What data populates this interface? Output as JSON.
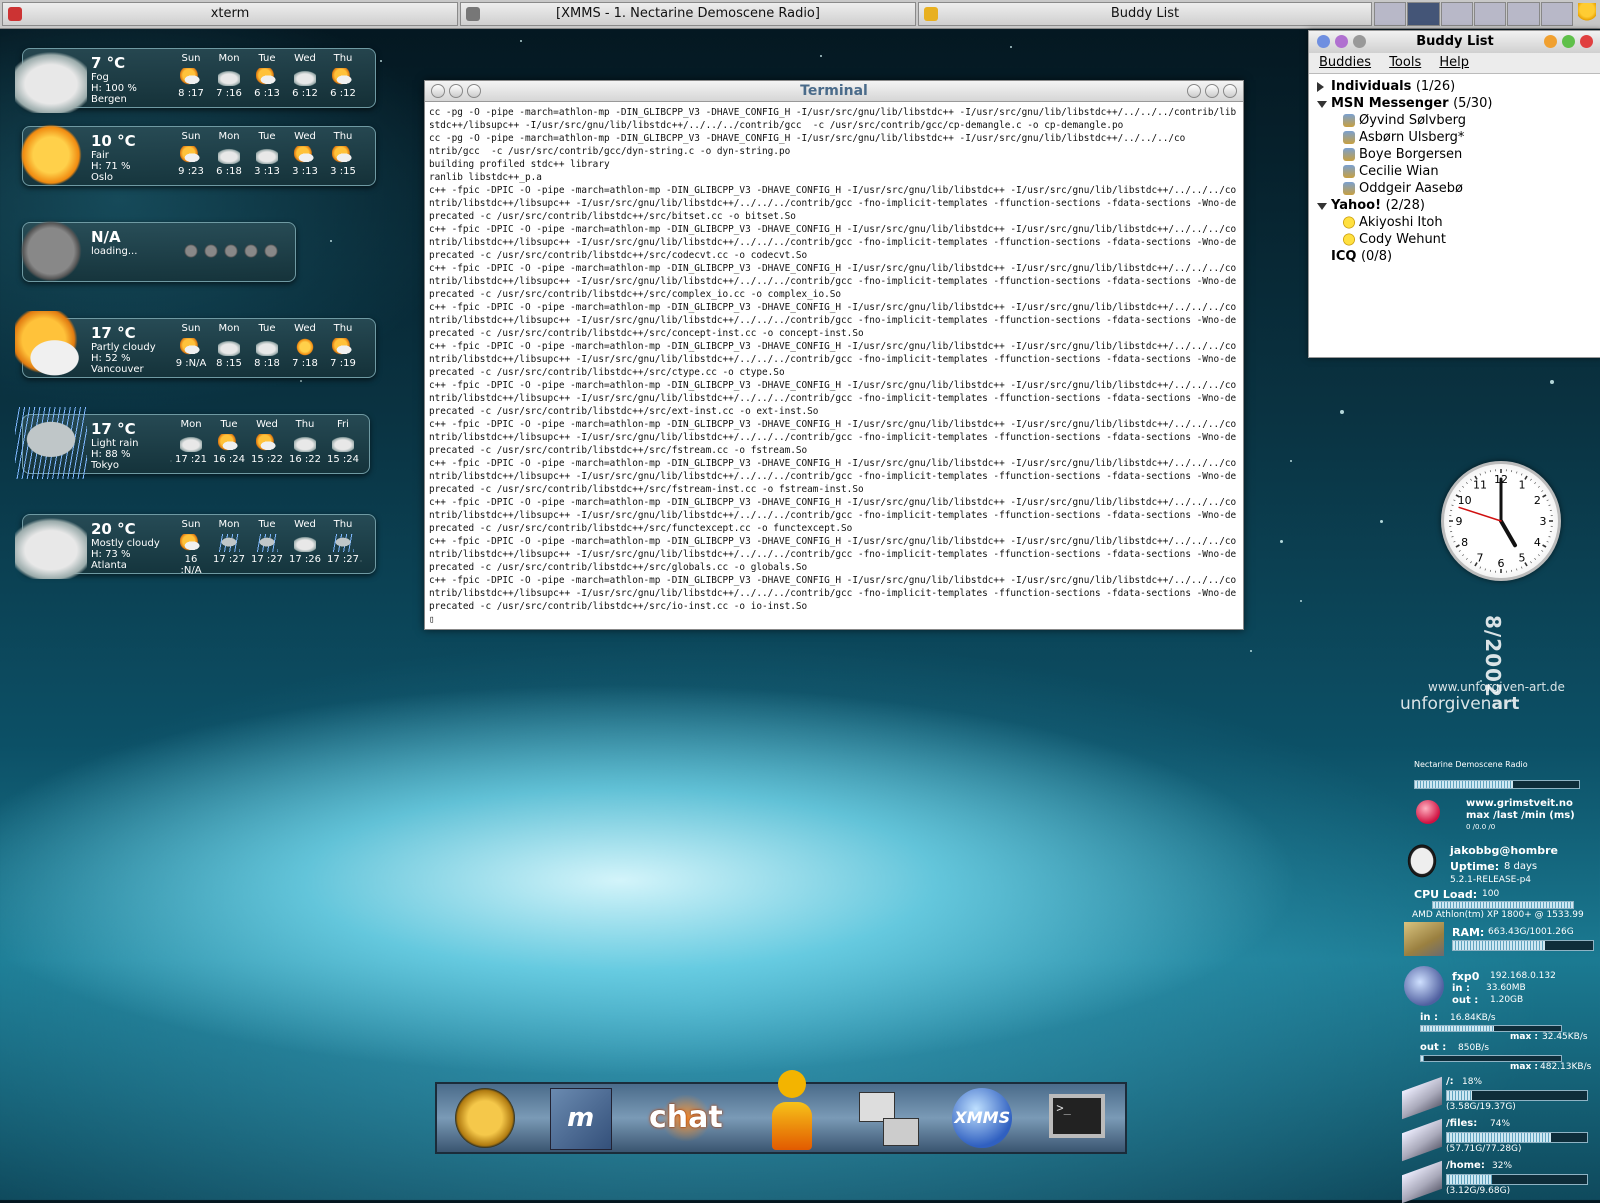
{
  "taskbar": {
    "tasks": [
      {
        "label": "xterm"
      },
      {
        "label": "[XMMS - 1. Nectarine Demoscene Radio]"
      },
      {
        "label": "Buddy List"
      }
    ]
  },
  "weather": [
    {
      "temp": "7 °C",
      "cond": "Fog",
      "humidity": "H: 100 %",
      "city": "Bergen",
      "icon": "fog-icon",
      "forecast": [
        {
          "day": "Sun",
          "time": "8 :17",
          "icon": "partly-sunny-icon"
        },
        {
          "day": "Mon",
          "time": "7 :16",
          "icon": "cloudy-icon"
        },
        {
          "day": "Tue",
          "time": "6 :13",
          "icon": "partly-sunny-icon"
        },
        {
          "day": "Wed",
          "time": "6 :12",
          "icon": "cloudy-icon"
        },
        {
          "day": "Thu",
          "time": "6 :12",
          "icon": "partly-sunny-icon"
        }
      ]
    },
    {
      "temp": "10 °C",
      "cond": "Fair",
      "humidity": "H: 71 %",
      "city": "Oslo",
      "icon": "sun-icon",
      "forecast": [
        {
          "day": "Sun",
          "time": "9 :23",
          "icon": "partly-sunny-icon"
        },
        {
          "day": "Mon",
          "time": "6 :18",
          "icon": "cloudy-icon"
        },
        {
          "day": "Tue",
          "time": "3 :13",
          "icon": "cloudy-icon"
        },
        {
          "day": "Wed",
          "time": "3 :13",
          "icon": "partly-sunny-icon"
        },
        {
          "day": "Thu",
          "time": "3 :15",
          "icon": "partly-sunny-icon"
        }
      ]
    },
    {
      "temp": "N/A",
      "cond": "loading...",
      "humidity": "",
      "city": "",
      "icon": "unknown-icon",
      "forecast": []
    },
    {
      "temp": "17 °C",
      "cond": "Partly cloudy",
      "humidity": "H: 52 %",
      "city": "Vancouver",
      "icon": "partly-cloudy-icon",
      "forecast": [
        {
          "day": "Sun",
          "time": "9 :N/A",
          "icon": "partly-sunny-icon"
        },
        {
          "day": "Mon",
          "time": "8 :15",
          "icon": "cloudy-icon"
        },
        {
          "day": "Tue",
          "time": "8 :18",
          "icon": "cloudy-icon"
        },
        {
          "day": "Wed",
          "time": "7 :18",
          "icon": "sun-icon"
        },
        {
          "day": "Thu",
          "time": "7 :19",
          "icon": "partly-sunny-icon"
        }
      ]
    },
    {
      "temp": "17 °C",
      "cond": "Light rain",
      "humidity": "H: 88 %",
      "city": "Tokyo",
      "icon": "rain-icon",
      "forecast": [
        {
          "day": "Mon",
          "time": "17 :21",
          "icon": "cloudy-icon"
        },
        {
          "day": "Tue",
          "time": "16 :24",
          "icon": "partly-sunny-icon"
        },
        {
          "day": "Wed",
          "time": "15 :22",
          "icon": "partly-sunny-icon"
        },
        {
          "day": "Thu",
          "time": "16 :22",
          "icon": "cloudy-icon"
        },
        {
          "day": "Fri",
          "time": "15 :24",
          "icon": "cloudy-icon"
        }
      ]
    },
    {
      "temp": "20 °C",
      "cond": "Mostly cloudy",
      "humidity": "H: 73 %",
      "city": "Atlanta",
      "icon": "mostly-cloudy-icon",
      "forecast": [
        {
          "day": "Sun",
          "time": "16 :N/A",
          "icon": "partly-sunny-icon"
        },
        {
          "day": "Mon",
          "time": "17 :27",
          "icon": "thunder-icon"
        },
        {
          "day": "Tue",
          "time": "17 :27",
          "icon": "thunder-icon"
        },
        {
          "day": "Wed",
          "time": "17 :26",
          "icon": "cloudy-icon"
        },
        {
          "day": "Thu",
          "time": "17 :27",
          "icon": "thunder-icon"
        }
      ]
    }
  ],
  "terminal": {
    "title": "Terminal",
    "text": "cc -pg -O -pipe -march=athlon-mp -DIN_GLIBCPP_V3 -DHAVE_CONFIG_H -I/usr/src/gnu/lib/libstdc++ -I/usr/src/gnu/lib/libstdc++/../../../contrib/libstdc++/libsupc++ -I/usr/src/gnu/lib/libstdc++/../../../contrib/gcc  -c /usr/src/contrib/gcc/cp-demangle.c -o cp-demangle.po\ncc -pg -O -pipe -march=athlon-mp -DIN_GLIBCPP_V3 -DHAVE_CONFIG_H -I/usr/src/gnu/lib/libstdc++ -I/usr/src/gnu/lib/libstdc++/../../../co\nntrib/gcc  -c /usr/src/contrib/gcc/dyn-string.c -o dyn-string.po\nbuilding profiled stdc++ library\nranlib libstdc++_p.a\nc++ -fpic -DPIC -O -pipe -march=athlon-mp -DIN_GLIBCPP_V3 -DHAVE_CONFIG_H -I/usr/src/gnu/lib/libstdc++ -I/usr/src/gnu/lib/libstdc++/../../../contrib/libstdc++/libsupc++ -I/usr/src/gnu/lib/libstdc++/../../../contrib/gcc -fno-implicit-templates -ffunction-sections -fdata-sections -Wno-deprecated -c /usr/src/contrib/libstdc++/src/bitset.cc -o bitset.So\nc++ -fpic -DPIC -O -pipe -march=athlon-mp -DIN_GLIBCPP_V3 -DHAVE_CONFIG_H -I/usr/src/gnu/lib/libstdc++ -I/usr/src/gnu/lib/libstdc++/../../../contrib/libstdc++/libsupc++ -I/usr/src/gnu/lib/libstdc++/../../../contrib/gcc -fno-implicit-templates -ffunction-sections -fdata-sections -Wno-deprecated -c /usr/src/contrib/libstdc++/src/codecvt.cc -o codecvt.So\nc++ -fpic -DPIC -O -pipe -march=athlon-mp -DIN_GLIBCPP_V3 -DHAVE_CONFIG_H -I/usr/src/gnu/lib/libstdc++ -I/usr/src/gnu/lib/libstdc++/../../../contrib/libstdc++/libsupc++ -I/usr/src/gnu/lib/libstdc++/../../../contrib/gcc -fno-implicit-templates -ffunction-sections -fdata-sections -Wno-deprecated -c /usr/src/contrib/libstdc++/src/complex_io.cc -o complex_io.So\nc++ -fpic -DPIC -O -pipe -march=athlon-mp -DIN_GLIBCPP_V3 -DHAVE_CONFIG_H -I/usr/src/gnu/lib/libstdc++ -I/usr/src/gnu/lib/libstdc++/../../../contrib/libstdc++/libsupc++ -I/usr/src/gnu/lib/libstdc++/../../../contrib/gcc -fno-implicit-templates -ffunction-sections -fdata-sections -Wno-deprecated -c /usr/src/contrib/libstdc++/src/concept-inst.cc -o concept-inst.So\nc++ -fpic -DPIC -O -pipe -march=athlon-mp -DIN_GLIBCPP_V3 -DHAVE_CONFIG_H -I/usr/src/gnu/lib/libstdc++ -I/usr/src/gnu/lib/libstdc++/../../../contrib/libstdc++/libsupc++ -I/usr/src/gnu/lib/libstdc++/../../../contrib/gcc -fno-implicit-templates -ffunction-sections -fdata-sections -Wno-deprecated -c /usr/src/contrib/libstdc++/src/ctype.cc -o ctype.So\nc++ -fpic -DPIC -O -pipe -march=athlon-mp -DIN_GLIBCPP_V3 -DHAVE_CONFIG_H -I/usr/src/gnu/lib/libstdc++ -I/usr/src/gnu/lib/libstdc++/../../../contrib/libstdc++/libsupc++ -I/usr/src/gnu/lib/libstdc++/../../../contrib/gcc -fno-implicit-templates -ffunction-sections -fdata-sections -Wno-deprecated -c /usr/src/contrib/libstdc++/src/ext-inst.cc -o ext-inst.So\nc++ -fpic -DPIC -O -pipe -march=athlon-mp -DIN_GLIBCPP_V3 -DHAVE_CONFIG_H -I/usr/src/gnu/lib/libstdc++ -I/usr/src/gnu/lib/libstdc++/../../../contrib/libstdc++/libsupc++ -I/usr/src/gnu/lib/libstdc++/../../../contrib/gcc -fno-implicit-templates -ffunction-sections -fdata-sections -Wno-deprecated -c /usr/src/contrib/libstdc++/src/fstream.cc -o fstream.So\nc++ -fpic -DPIC -O -pipe -march=athlon-mp -DIN_GLIBCPP_V3 -DHAVE_CONFIG_H -I/usr/src/gnu/lib/libstdc++ -I/usr/src/gnu/lib/libstdc++/../../../contrib/libstdc++/libsupc++ -I/usr/src/gnu/lib/libstdc++/../../../contrib/gcc -fno-implicit-templates -ffunction-sections -fdata-sections -Wno-deprecated -c /usr/src/contrib/libstdc++/src/fstream-inst.cc -o fstream-inst.So\nc++ -fpic -DPIC -O -pipe -march=athlon-mp -DIN_GLIBCPP_V3 -DHAVE_CONFIG_H -I/usr/src/gnu/lib/libstdc++ -I/usr/src/gnu/lib/libstdc++/../../../contrib/libstdc++/libsupc++ -I/usr/src/gnu/lib/libstdc++/../../../contrib/gcc -fno-implicit-templates -ffunction-sections -fdata-sections -Wno-deprecated -c /usr/src/contrib/libstdc++/src/functexcept.cc -o functexcept.So\nc++ -fpic -DPIC -O -pipe -march=athlon-mp -DIN_GLIBCPP_V3 -DHAVE_CONFIG_H -I/usr/src/gnu/lib/libstdc++ -I/usr/src/gnu/lib/libstdc++/../../../contrib/libstdc++/libsupc++ -I/usr/src/gnu/lib/libstdc++/../../../contrib/gcc -fno-implicit-templates -ffunction-sections -fdata-sections -Wno-deprecated -c /usr/src/contrib/libstdc++/src/globals.cc -o globals.So\nc++ -fpic -DPIC -O -pipe -march=athlon-mp -DIN_GLIBCPP_V3 -DHAVE_CONFIG_H -I/usr/src/gnu/lib/libstdc++ -I/usr/src/gnu/lib/libstdc++/../../../contrib/libstdc++/libsupc++ -I/usr/src/gnu/lib/libstdc++/../../../contrib/gcc -fno-implicit-templates -ffunction-sections -fdata-sections -Wno-deprecated -c /usr/src/contrib/libstdc++/src/io-inst.cc -o io-inst.So\n▯"
  },
  "buddy": {
    "title": "Buddy List",
    "menu": [
      "Buddies",
      "Tools",
      "Help"
    ],
    "groups": [
      {
        "name": "Individuals",
        "count": "(1/26)",
        "expanded": false,
        "contacts": []
      },
      {
        "name": "MSN Messenger",
        "count": "(5/30)",
        "expanded": true,
        "contacts": [
          "Øyvind Sølvberg",
          "Asbørn Ulsberg*",
          "Boye Borgersen",
          "Cecilie Wian",
          "Oddgeir Aasebø"
        ]
      },
      {
        "name": "Yahoo!",
        "count": "(2/28)",
        "expanded": true,
        "contacts": [
          "Akiyoshi Itoh",
          "Cody Wehunt"
        ]
      },
      {
        "name": "ICQ",
        "count": "(0/8)",
        "expanded": null,
        "contacts": []
      }
    ]
  },
  "clock": {
    "hour": 5,
    "minute": 0,
    "second": 48
  },
  "branding": {
    "date": "8/2002",
    "url": "www.unforgiven-art.de",
    "name": "unforgiven",
    "name_bold": "art"
  },
  "dock": {
    "items": [
      "mail-icon",
      "mozilla-icon",
      "xchat-icon",
      "gaim-icon",
      "file-manager-icon",
      "xmms-icon",
      "terminal-icon"
    ],
    "chat_label": "chat",
    "xmms_label": "XMMS"
  },
  "gkrellm": {
    "radio": "Nectarine Demoscene Radio",
    "ping_host": "www.grimstveit.no",
    "ping_label": "max /last /min (ms)",
    "ping_values": "0   /0.0   /0",
    "user": "jakobbg@hombre",
    "uptime_label": "Uptime:",
    "uptime": "8 days",
    "release": "5.2.1-RELEASE-p4",
    "cpu_label": "CPU Load:",
    "cpu_value": "100",
    "cpu_model": "AMD Athlon(tm) XP 1800+ @ 1533.99",
    "ram_label": "RAM:",
    "ram_value": "663.43G/1001.26G",
    "net_if": "fxp0",
    "net_ip": "192.168.0.132",
    "net_in_label": "in :",
    "net_in": "33.60MB",
    "net_out_label": "out :",
    "net_out": "1.20GB",
    "rate_in_label": "in :",
    "rate_in": "16.84KB/s",
    "rate_in_max_label": "max :",
    "rate_in_max": "32.45KB/s",
    "rate_out_label": "out :",
    "rate_out": "850B/s",
    "rate_out_max_label": "max :",
    "rate_out_max": "482.13KB/s",
    "disks": [
      {
        "mount": "/:",
        "pct": "18%",
        "usage": "(3.58G/19.37G)",
        "fill": 0.18
      },
      {
        "mount": "/files:",
        "pct": "74%",
        "usage": "(57.71G/77.28G)",
        "fill": 0.74
      },
      {
        "mount": "/home:",
        "pct": "32%",
        "usage": "(3.12G/9.68G)",
        "fill": 0.32
      }
    ],
    "cpu_fill": 1.0,
    "ram_fill": 0.66
  }
}
